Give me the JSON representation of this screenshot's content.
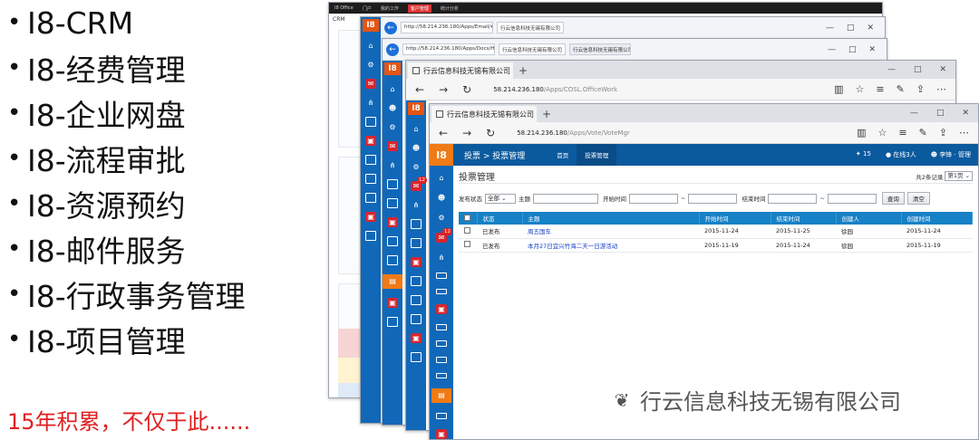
{
  "bullets": [
    "I8-CRM",
    "I8-经费管理",
    "I8-企业网盘",
    "I8-流程审批",
    "I8-资源预约",
    "I8-邮件服务",
    "I8-行政事务管理",
    "I8-项目管理"
  ],
  "slogan": "15年积累，不仅于此......",
  "watermark": "行云信息科技无锡有限公司",
  "crm_window": {
    "brand": "I8 Office",
    "nav": [
      "门户",
      "我的工作",
      "客户管理",
      "统计分析"
    ],
    "title": "CRM"
  },
  "email_window": {
    "address": "http://58.214.236.180/Apps/Email/#5d",
    "tab_title": "行云信息科技无锡有限公司",
    "window_buttons": [
      "—",
      "□",
      "✕"
    ]
  },
  "docs_window": {
    "address": "http://58.214.236.180/Apps/Docs/Home",
    "tab_title": "行云信息科技无锡有限公司",
    "window_buttons": [
      "—",
      "□",
      "✕"
    ]
  },
  "office_window": {
    "tab_title": "行云信息科技无锡有限公司",
    "address_host": "58.214.236.180",
    "address_path": "/Apps/COSL.OfficeWork",
    "window_buttons": [
      "—",
      "□",
      "✕"
    ]
  },
  "vote_window": {
    "tab_title": "行云信息科技无锡有限公司",
    "address_host": "58.214.236.180",
    "address_path": "/Apps/Vote/VoteMgr",
    "window_buttons": [
      "—",
      "□",
      "✕"
    ],
    "app": {
      "logo": "I8",
      "breadcrumb": "投票 > 投票管理",
      "nav": [
        "首页",
        "投票管理"
      ],
      "notifications": "15",
      "online": "在线3人",
      "user": "李锋 · 管理",
      "mail_badge": "12"
    },
    "page": {
      "title": "投票管理",
      "total_label": "共2条记录",
      "page_select": "第1页",
      "filters": {
        "status_label": "发布状态",
        "status_value": "全部",
        "subject_label": "主题",
        "start_label": "开始时间",
        "end_label": "结束时间",
        "range_sep": "~",
        "query_button": "查询",
        "clear_button": "清空"
      },
      "columns": [
        "状态",
        "主题",
        "开始时间",
        "结束时间",
        "创建人",
        "创建时间"
      ],
      "rows": [
        [
          "已发布",
          "周五国车",
          "2015-11-24",
          "2015-11-25",
          "徐园",
          "2015-11-24"
        ],
        [
          "已发布",
          "本月27日宜兴竹海二天一日游活动",
          "2015-11-19",
          "2015-11-24",
          "徐园",
          "2015-11-19"
        ]
      ]
    }
  },
  "colors": {
    "rail": "#1168b8",
    "app_header": "#0c5a9e",
    "accent_orange": "#f07a16",
    "table_header": "#1681c6",
    "link": "#1840c8",
    "slogan": "#e02020"
  }
}
